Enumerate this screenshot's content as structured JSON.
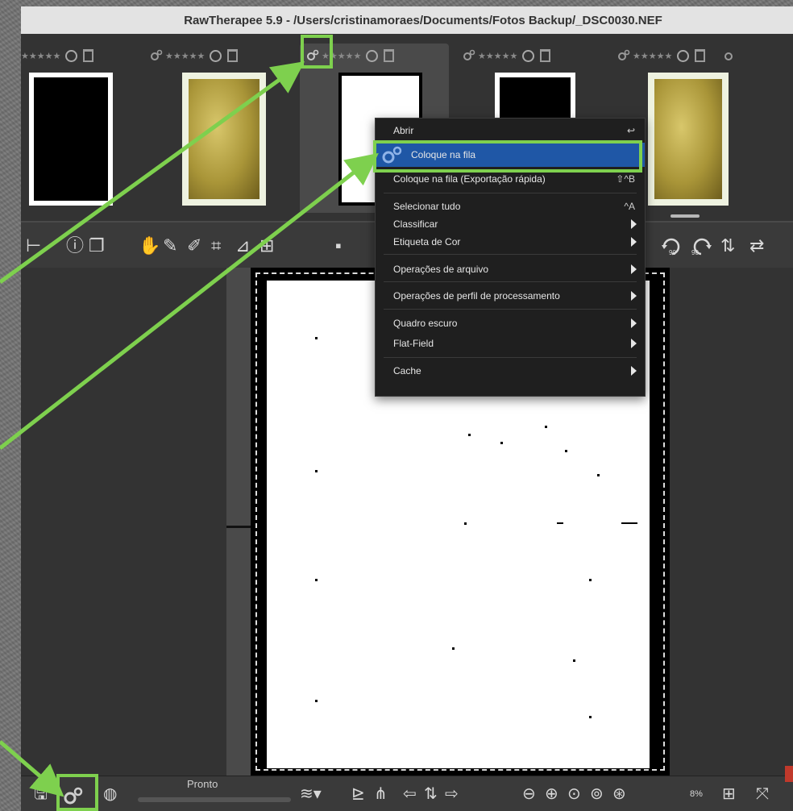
{
  "window": {
    "title": "RawTherapee 5.9 - /Users/cristinamoraes/Documents/Fotos Backup/_DSC0030.NEF"
  },
  "filmstrip": {
    "thumbnails": [
      {
        "name": "thumb-1",
        "image": "black-document",
        "selected": false
      },
      {
        "name": "thumb-2",
        "image": "aged-paper-document",
        "selected": false
      },
      {
        "name": "thumb-3",
        "image": "white-document",
        "selected": true
      },
      {
        "name": "thumb-4",
        "image": "black-document",
        "selected": false
      },
      {
        "name": "thumb-5",
        "image": "aged-paper-document",
        "selected": false
      }
    ],
    "thumb_icons": [
      "gear-icon",
      "star-icon",
      "circle-icon",
      "trash-icon"
    ]
  },
  "context_menu": {
    "items": [
      {
        "label": "Abrir",
        "accel": "↩"
      },
      {
        "label": "Coloque na fila",
        "icon": "gear-icon",
        "highlighted": true
      },
      {
        "label": "Coloque na fila (Exportação rápida)",
        "accel": "⇧^B"
      },
      {
        "label": "Selecionar tudo",
        "accel": "^A"
      },
      {
        "label": "Classificar",
        "submenu": true
      },
      {
        "label": "Etiqueta de Cor",
        "submenu": true
      },
      {
        "label": "Operações de arquivo",
        "submenu": true
      },
      {
        "label": "Operações de perfil de processamento",
        "submenu": true
      },
      {
        "label": "Quadro escuro",
        "submenu": true
      },
      {
        "label": "Flat-Field",
        "submenu": true
      },
      {
        "label": "Cache",
        "submenu": true
      }
    ]
  },
  "toolbar": {
    "icons": [
      "info-icon",
      "compare-icon",
      "hand-icon",
      "picker-icon",
      "picker-icon-2",
      "crop-icon",
      "straighten-icon",
      "perspective-icon"
    ],
    "rotate_icons": [
      "rotate-left-90-icon",
      "rotate-right-90-icon",
      "flip-vertical-icon",
      "flip-horizontal-icon"
    ],
    "rotate_left_label": "90",
    "rotate_right_label": "90"
  },
  "bottombar": {
    "status": "Pronto",
    "zoom": "8%"
  },
  "colors": {
    "highlight_box": "#7ed04e",
    "menu_selection": "#1f57a6",
    "window_bg": "#2b2b2b"
  }
}
